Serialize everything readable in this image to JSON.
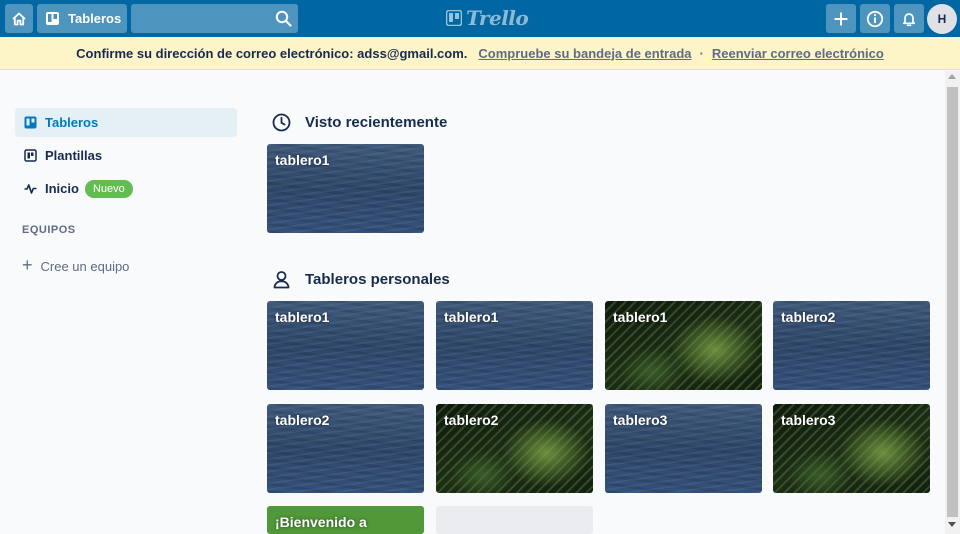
{
  "header": {
    "boards_label": "Tableros",
    "logo_text": "Trello",
    "avatar_initial": "H",
    "search_placeholder": ""
  },
  "banner": {
    "message": "Confirme su dirección de correo electrónico: adss@gmail.com.",
    "link1": "Compruebe su bandeja de entrada",
    "separator": "·",
    "link2": "Reenviar correo electrónico"
  },
  "sidebar": {
    "items": [
      {
        "label": "Tableros",
        "icon": "board-icon"
      },
      {
        "label": "Plantillas",
        "icon": "template-icon"
      },
      {
        "label": "Inicio",
        "icon": "activity-icon",
        "badge": "Nuevo"
      }
    ],
    "section_title": "EQUIPOS",
    "create_team": "Cree un equipo"
  },
  "recent": {
    "title": "Visto recientemente",
    "boards": [
      {
        "name": "tablero1",
        "background": "water"
      }
    ]
  },
  "personal": {
    "title": "Tableros personales",
    "boards": [
      {
        "name": "tablero1",
        "background": "water"
      },
      {
        "name": "tablero1",
        "background": "water"
      },
      {
        "name": "tablero1",
        "background": "palm"
      },
      {
        "name": "tablero2",
        "background": "water"
      },
      {
        "name": "tablero2",
        "background": "water"
      },
      {
        "name": "tablero2",
        "background": "palm"
      },
      {
        "name": "tablero3",
        "background": "water"
      },
      {
        "name": "tablero3",
        "background": "palm"
      },
      {
        "name": "¡Bienvenido a",
        "background": "green"
      }
    ]
  },
  "colors": {
    "header": "#0067a3",
    "banner": "#fdf4c7",
    "active_nav": "#e4f0f6",
    "accent": "#0079bf",
    "badge": "#61bd4f"
  }
}
